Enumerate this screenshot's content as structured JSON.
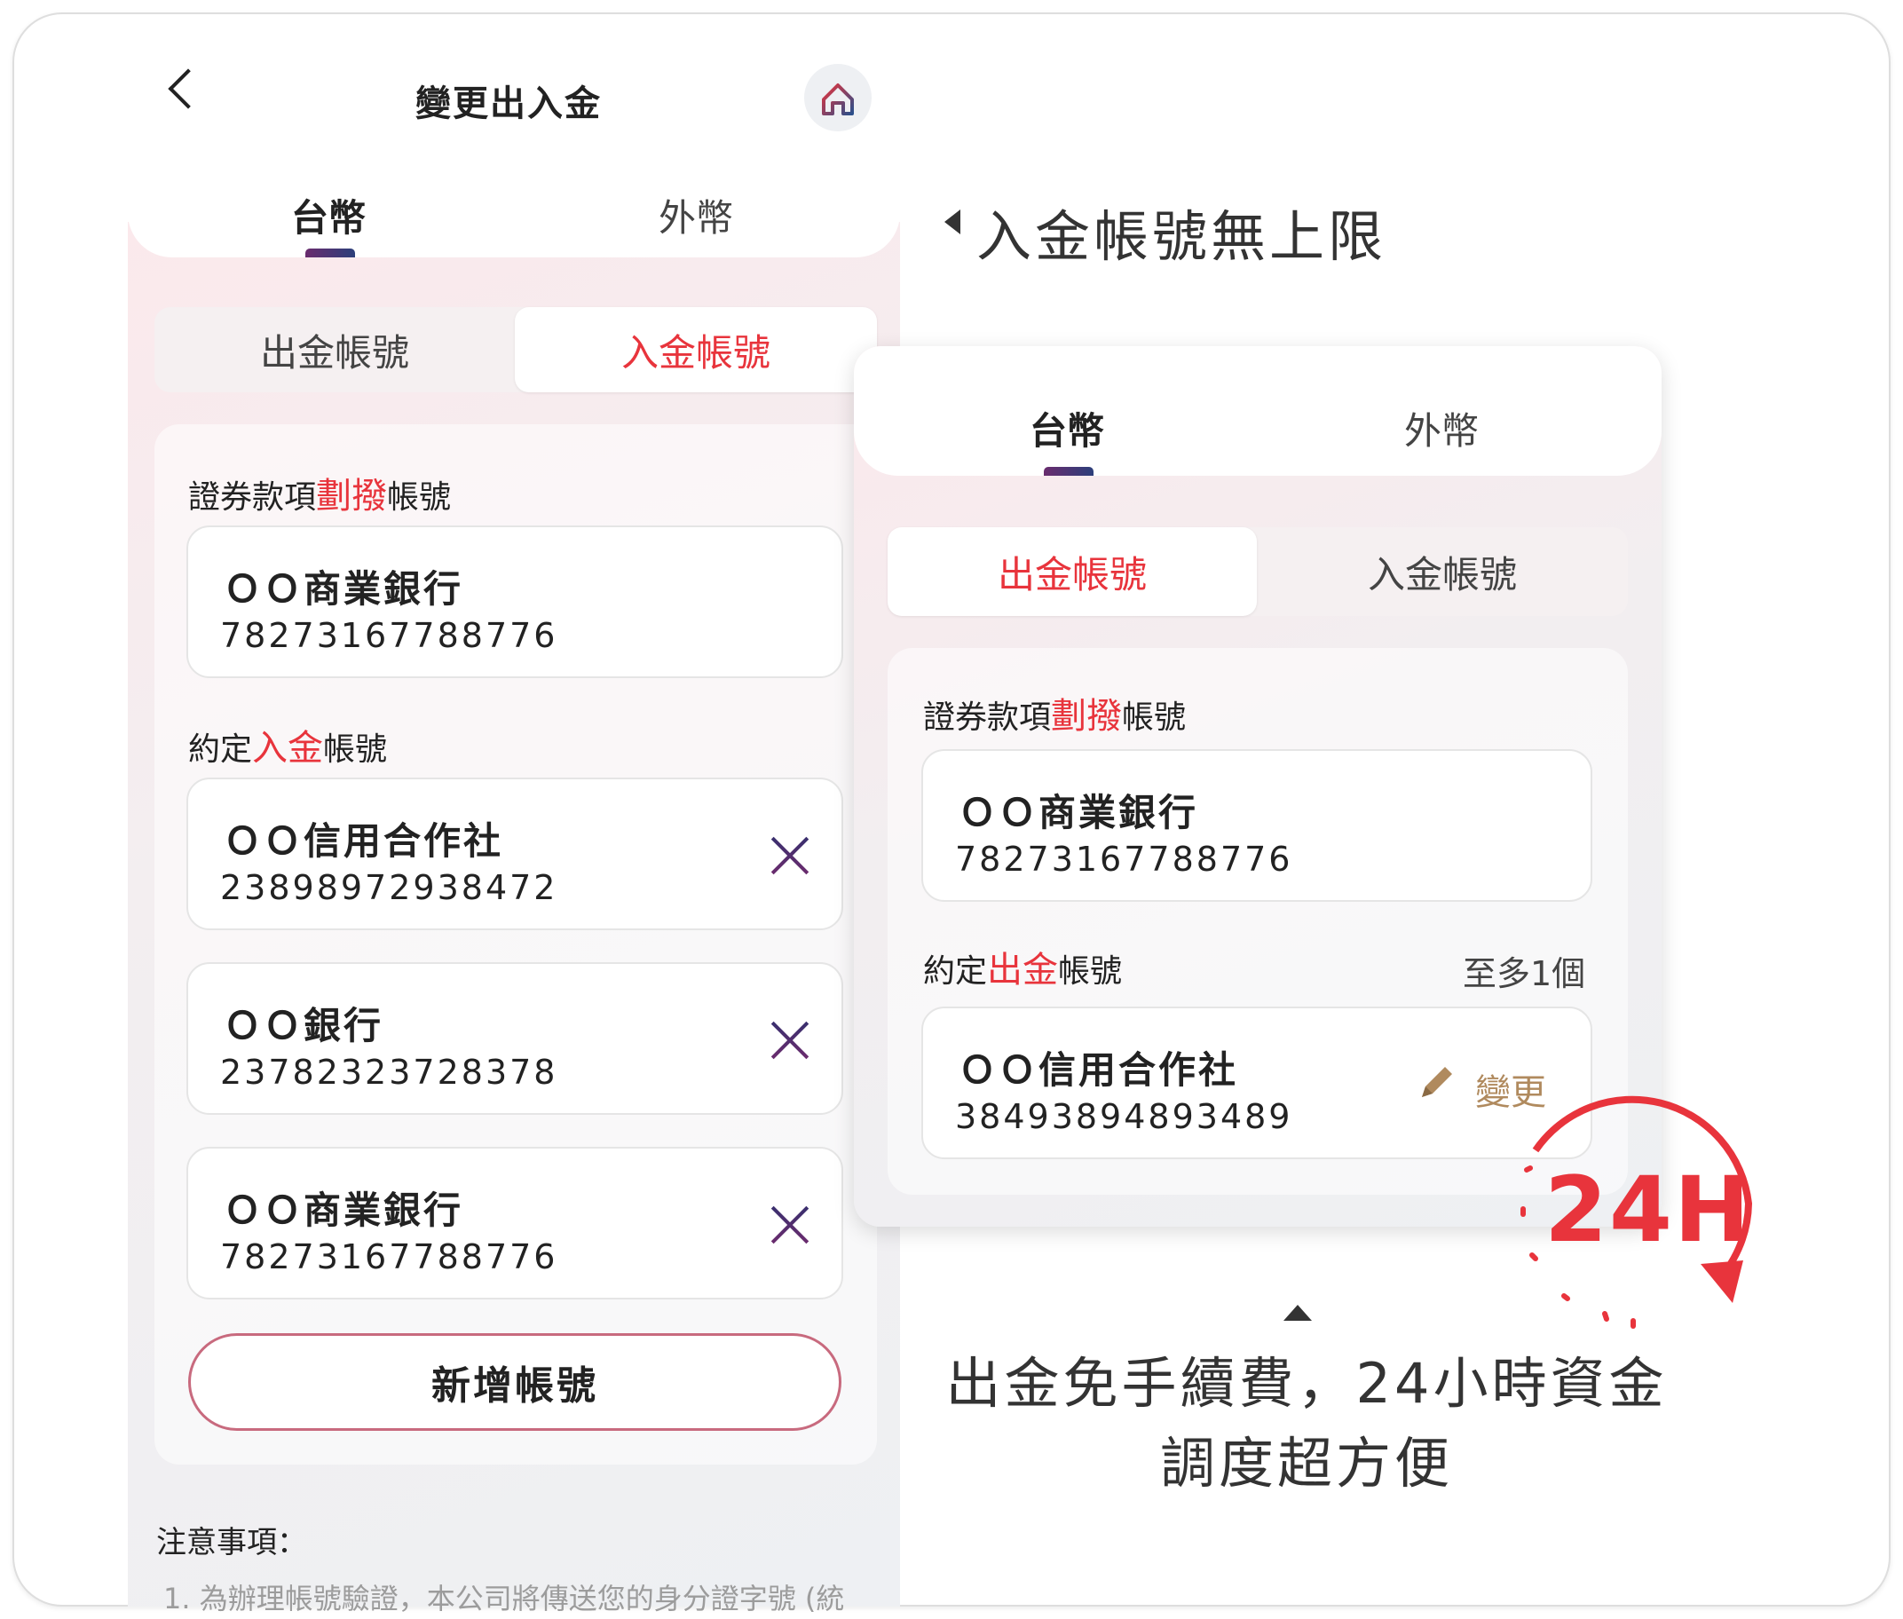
{
  "header": {
    "title": "變更出入金"
  },
  "left": {
    "tabs": [
      "台幣",
      "外幣"
    ],
    "segments": [
      "出金帳號",
      "入金帳號"
    ],
    "transfer_label": {
      "pre": "證券款項",
      "hl": "劃撥",
      "post": "帳號"
    },
    "transfer_account": {
      "bank": "ＯＯ商業銀行",
      "number": "78273167788776"
    },
    "deposit_label": {
      "pre": "約定",
      "hl": "入金",
      "post": "帳號"
    },
    "deposit_accounts": [
      {
        "bank": "ＯＯ信用合作社",
        "number": "23898972938472"
      },
      {
        "bank": "ＯＯ銀行",
        "number": "23782323728378"
      },
      {
        "bank": "ＯＯ商業銀行",
        "number": "78273167788776"
      }
    ],
    "add_button": "新增帳號",
    "notice_title": "注意事項：",
    "notice_line": "1. 為辦理帳號驗證，本公司將傳送您的身分證字號 (統"
  },
  "right": {
    "heading": "入金帳號無上限",
    "tabs": [
      "台幣",
      "外幣"
    ],
    "segments": [
      "出金帳號",
      "入金帳號"
    ],
    "transfer_label": {
      "pre": "證券款項",
      "hl": "劃撥",
      "post": "帳號"
    },
    "transfer_account": {
      "bank": "ＯＯ商業銀行",
      "number": "78273167788776"
    },
    "withdraw_label": {
      "pre": "約定",
      "hl": "出金",
      "post": "帳號"
    },
    "limit": "至多1個",
    "withdraw_account": {
      "bank": "ＯＯ信用合作社",
      "number": "38493894893489"
    },
    "change_label": "變更",
    "badge": "24H",
    "caption_line1": "出金免手續費，24小時資金",
    "caption_line2": "調度超方便"
  },
  "colors": {
    "accent_red": "#e8343c",
    "change_gold": "#b08a5e",
    "tab_indicator": "#4a2f6e"
  }
}
